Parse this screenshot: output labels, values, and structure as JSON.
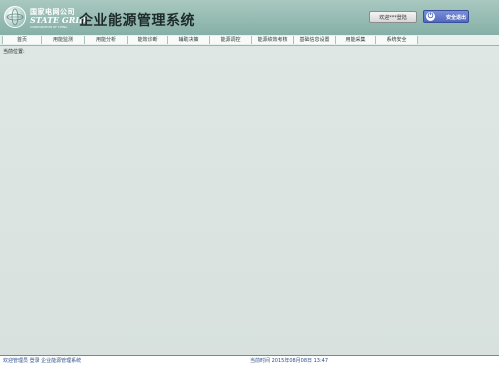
{
  "brand": {
    "name_cn": "国家电网公司",
    "name_en": "STATE GRID",
    "sub": "CORPORATION OF CHINA"
  },
  "title": "企业能源管理系统",
  "header": {
    "welcome": "欢迎***登陆",
    "logout": "安全退出"
  },
  "nav": [
    "首页",
    "用能监测",
    "用能分析",
    "能效诊断",
    "辅助决策",
    "能源调控",
    "能源绩效考核",
    "基础信息设置",
    "用能采集",
    "系统安全"
  ],
  "location_label": "当前位置:",
  "footer": {
    "left": "欢迎管理员 登录 企业能源管理系统",
    "right": "当前时间 2015年08月08日 13:47"
  }
}
